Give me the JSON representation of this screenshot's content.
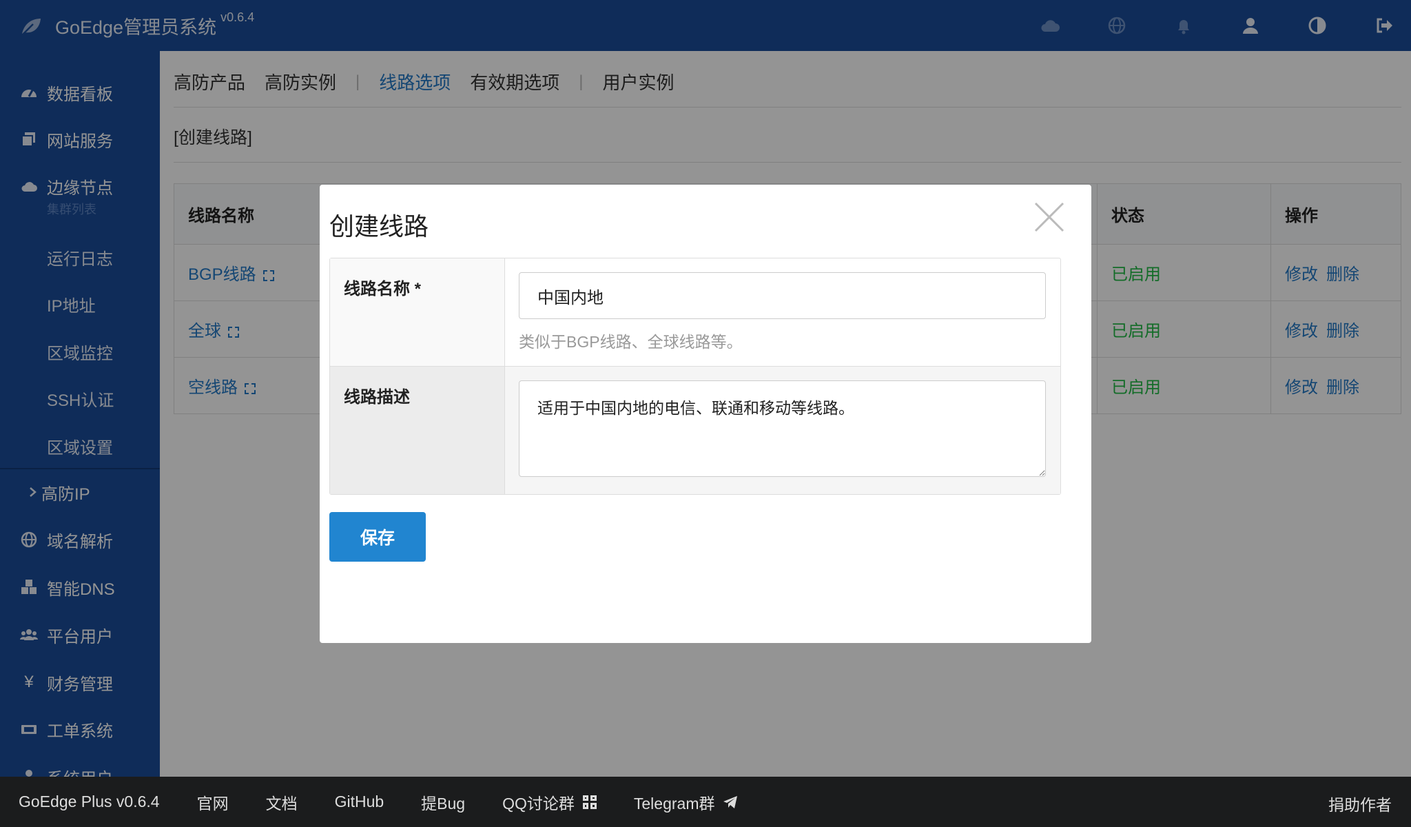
{
  "app": {
    "title": "GoEdge管理员系统",
    "version": "v0.6.4"
  },
  "topbar_icons": [
    "cloud-icon",
    "globe-icon",
    "bell-icon",
    "user-icon",
    "theme-icon",
    "logout-icon"
  ],
  "sidebar": {
    "items": [
      {
        "label": "数据看板",
        "icon": "dashboard-icon"
      },
      {
        "label": "网站服务",
        "icon": "copy-icon"
      },
      {
        "label": "边缘节点",
        "icon": "cloud-icon",
        "sub": "集群列表"
      },
      {
        "label": "运行日志"
      },
      {
        "label": "IP地址"
      },
      {
        "label": "区域监控"
      },
      {
        "label": "SSH认证"
      },
      {
        "label": "区域设置"
      },
      {
        "label": "高防IP",
        "icon": "chevron-right-icon"
      },
      {
        "label": "域名解析",
        "icon": "globe-icon"
      },
      {
        "label": "智能DNS",
        "icon": "cubes-icon"
      },
      {
        "label": "平台用户",
        "icon": "users-icon"
      },
      {
        "label": "财务管理",
        "icon": "yen-icon"
      },
      {
        "label": "工单系统",
        "icon": "ticket-icon"
      },
      {
        "label": "系统用户",
        "icon": "user-tie-icon"
      }
    ]
  },
  "tabs": [
    {
      "label": "高防产品",
      "active": false
    },
    {
      "label": "高防实例",
      "active": false
    },
    {
      "label": "线路选项",
      "active": true
    },
    {
      "label": "有效期选项",
      "active": false
    },
    {
      "label": "用户实例",
      "active": false
    }
  ],
  "create_link": "[创建线路]",
  "table": {
    "headers": {
      "name": "线路名称",
      "status": "状态",
      "ops": "操作"
    },
    "rows": [
      {
        "name": "BGP线路",
        "status": "已启用",
        "edit": "修改",
        "delete": "删除"
      },
      {
        "name": "全球",
        "status": "已启用",
        "edit": "修改",
        "delete": "删除"
      },
      {
        "name": "空线路",
        "status": "已启用",
        "edit": "修改",
        "delete": "删除"
      }
    ]
  },
  "modal": {
    "title": "创建线路",
    "name_label": "线路名称 *",
    "name_value": "中国内地",
    "name_hint": "类似于BGP线路、全球线路等。",
    "desc_label": "线路描述",
    "desc_value": "适用于中国内地的电信、联通和移动等线路。",
    "save_label": "保存"
  },
  "footer": {
    "version": "GoEdge Plus v0.6.4",
    "links": [
      "官网",
      "文档",
      "GitHub",
      "提Bug",
      "QQ讨论群",
      "Telegram群"
    ],
    "donate": "捐助作者"
  }
}
